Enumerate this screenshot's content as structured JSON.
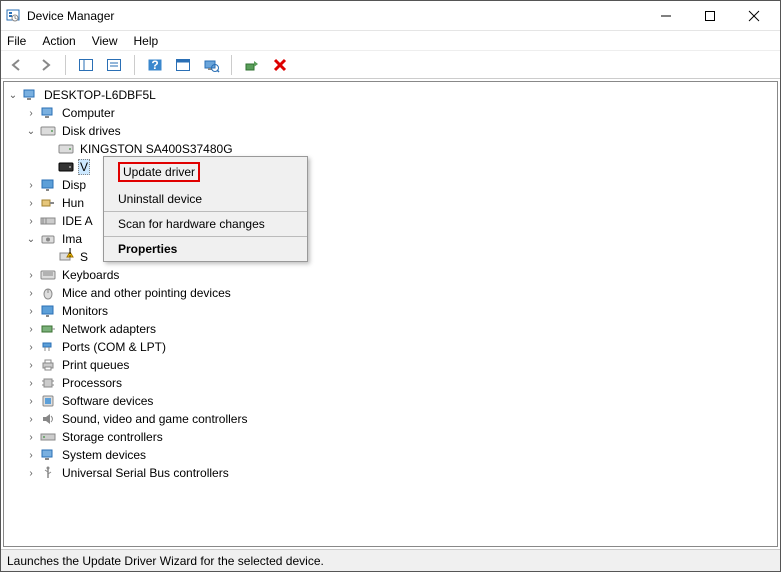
{
  "window": {
    "title": "Device Manager"
  },
  "menu": {
    "file": "File",
    "action": "Action",
    "view": "View",
    "help": "Help"
  },
  "tree": {
    "root": "DESKTOP-L6DBF5L",
    "nodes": {
      "computer": "Computer",
      "disk_drives": "Disk drives",
      "kingston": "KINGSTON SA400S37480G",
      "partial_v": "V",
      "display": "Disp",
      "hum": "Hun",
      "ide": "IDE A",
      "imaging": "Ima",
      "s": "S",
      "keyboards": "Keyboards",
      "mice": "Mice and other pointing devices",
      "monitors": "Monitors",
      "network": "Network adapters",
      "ports": "Ports (COM & LPT)",
      "print_queues": "Print queues",
      "processors": "Processors",
      "software": "Software devices",
      "sound": "Sound, video and game controllers",
      "storage": "Storage controllers",
      "system": "System devices",
      "usb": "Universal Serial Bus controllers"
    }
  },
  "context_menu": {
    "update": "Update driver",
    "uninstall": "Uninstall device",
    "scan": "Scan for hardware changes",
    "properties": "Properties"
  },
  "status": "Launches the Update Driver Wizard for the selected device."
}
